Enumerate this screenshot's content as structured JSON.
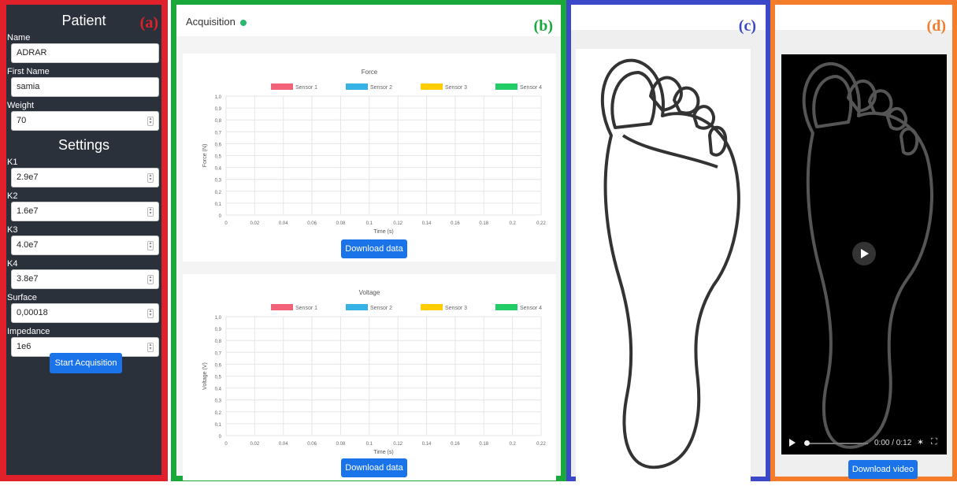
{
  "panel_a": {
    "tag": "(a)",
    "patient_heading": "Patient",
    "settings_heading": "Settings",
    "fields": [
      {
        "label": "Name",
        "value": "ADRAR",
        "spinner": false
      },
      {
        "label": "First Name",
        "value": "samia",
        "spinner": false
      },
      {
        "label": "Weight",
        "value": "70",
        "spinner": true
      }
    ],
    "settings": [
      {
        "label": "K1",
        "value": "2.9e7"
      },
      {
        "label": "K2",
        "value": "1.6e7"
      },
      {
        "label": "K3",
        "value": "4.0e7"
      },
      {
        "label": "K4",
        "value": "3.8e7"
      },
      {
        "label": "Surface",
        "value": "0,00018"
      },
      {
        "label": "Impedance",
        "value": "1e6"
      }
    ],
    "start_button": "Start Acquisition"
  },
  "panel_b": {
    "tag": "(b)",
    "title": "Acquisition",
    "status_color": "#2bb673",
    "download_label": "Download data",
    "legend": [
      {
        "name": "Sensor 1",
        "color": "#f2637a"
      },
      {
        "name": "Sensor 2",
        "color": "#36b3e6"
      },
      {
        "name": "Sensor 3",
        "color": "#ffcd00"
      },
      {
        "name": "Sensor 4",
        "color": "#22cc66"
      }
    ]
  },
  "panel_c": {
    "tag": "(c)"
  },
  "panel_d": {
    "tag": "(d)",
    "time": "0:00 / 0:12",
    "download_label": "Download video"
  },
  "chart_data": [
    {
      "type": "line",
      "title": "Force",
      "xlabel": "Time (s)",
      "ylabel": "Force (N)",
      "x_ticks": [
        "0",
        "0.02",
        "0.04",
        "0.06",
        "0.08",
        "0.1",
        "0.12",
        "0.14",
        "0.16",
        "0.18",
        "0.2",
        "0.22"
      ],
      "y_ticks": [
        "0",
        "0,1",
        "0,2",
        "0,3",
        "0,4",
        "0,5",
        "0,6",
        "0,7",
        "0,8",
        "0,9",
        "1,0"
      ],
      "xlim": [
        0,
        0.22
      ],
      "ylim": [
        0,
        1
      ],
      "series": [
        {
          "name": "Sensor 1",
          "values": []
        },
        {
          "name": "Sensor 2",
          "values": []
        },
        {
          "name": "Sensor 3",
          "values": []
        },
        {
          "name": "Sensor 4",
          "values": []
        }
      ],
      "grid": true,
      "legend": "top"
    },
    {
      "type": "line",
      "title": "Voltage",
      "xlabel": "Time (s)",
      "ylabel": "Voltage (V)",
      "x_ticks": [
        "0",
        "0.02",
        "0.04",
        "0.06",
        "0.08",
        "0.1",
        "0.12",
        "0.14",
        "0.16",
        "0.18",
        "0.2",
        "0.22"
      ],
      "y_ticks": [
        "0",
        "0,1",
        "0,2",
        "0,3",
        "0,4",
        "0,5",
        "0,6",
        "0,7",
        "0,8",
        "0,9",
        "1,0"
      ],
      "xlim": [
        0,
        0.22
      ],
      "ylim": [
        0,
        1
      ],
      "series": [
        {
          "name": "Sensor 1",
          "values": []
        },
        {
          "name": "Sensor 2",
          "values": []
        },
        {
          "name": "Sensor 3",
          "values": []
        },
        {
          "name": "Sensor 4",
          "values": []
        }
      ],
      "grid": true,
      "legend": "top"
    }
  ]
}
